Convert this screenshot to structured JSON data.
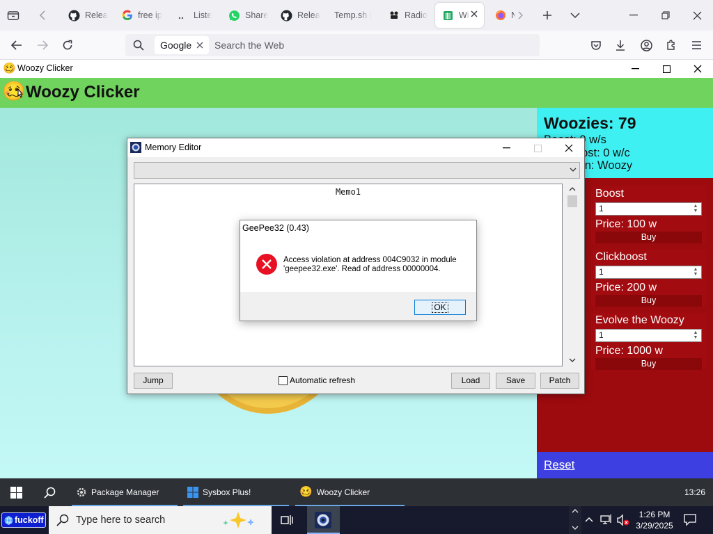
{
  "browser": {
    "tabs": [
      {
        "label": "Relea",
        "icon": "github-icon"
      },
      {
        "label": "free ip",
        "icon": "google-icon"
      },
      {
        "label": "Liste",
        "icon": "dots-icon"
      },
      {
        "label": "Share",
        "icon": "whatsapp-icon"
      },
      {
        "label": "Relea",
        "icon": "github-icon"
      },
      {
        "label": "Temp.sh |",
        "icon": ""
      },
      {
        "label": "Radio",
        "icon": "radio-icon"
      },
      {
        "label": "Wi",
        "icon": "sheet-icon",
        "active": true
      },
      {
        "label": "N",
        "icon": "firefox-icon"
      }
    ],
    "search_engine": "Google",
    "search_placeholder": "Search the Web"
  },
  "app": {
    "window_title": "Woozy Clicker",
    "header_title": "Woozy Clicker",
    "emoji": "🥴"
  },
  "stats": {
    "woozies": "Woozies: 79",
    "boost": "Boost: 0 w/s",
    "clickboost": "Clickboost: 0 w/c",
    "evolution": "Evolution: Woozy"
  },
  "shop": [
    {
      "title": "Boost",
      "qty": "1",
      "price": "Price: 100 w",
      "buy": "Buy"
    },
    {
      "title": "Clickboost",
      "qty": "1",
      "price": "Price: 200 w",
      "buy": "Buy"
    },
    {
      "title": "Evolve the Woozy",
      "qty": "1",
      "price": "Price: 1000 w",
      "buy": "Buy"
    }
  ],
  "reset_label": "Reset",
  "memory_editor": {
    "title": "Memory Editor",
    "memo_text": "Memo1",
    "jump": "Jump",
    "auto_refresh": "Automatic refresh",
    "load": "Load",
    "save": "Save",
    "patch": "Patch"
  },
  "error_dialog": {
    "title": "GeePee32 (0.43)",
    "line1": "Access violation at address 004C9032 in module",
    "line2": "'geepee32.exe'. Read of address 00000004.",
    "ok": "OK"
  },
  "inner_taskbar": {
    "items": [
      "Package Manager",
      "Sysbox Plus!",
      "Woozy Clicker"
    ],
    "clock": "13:26"
  },
  "host_taskbar": {
    "pill": "fuckoff",
    "search_text": "Type here to search",
    "time": "1:26 PM",
    "date": "3/29/2025"
  },
  "colors": {
    "header_green": "#6fd35e",
    "stats_cyan": "#3ff0f2",
    "panel_red": "#9e0b0e",
    "reset_blue": "#3d3fe0"
  }
}
